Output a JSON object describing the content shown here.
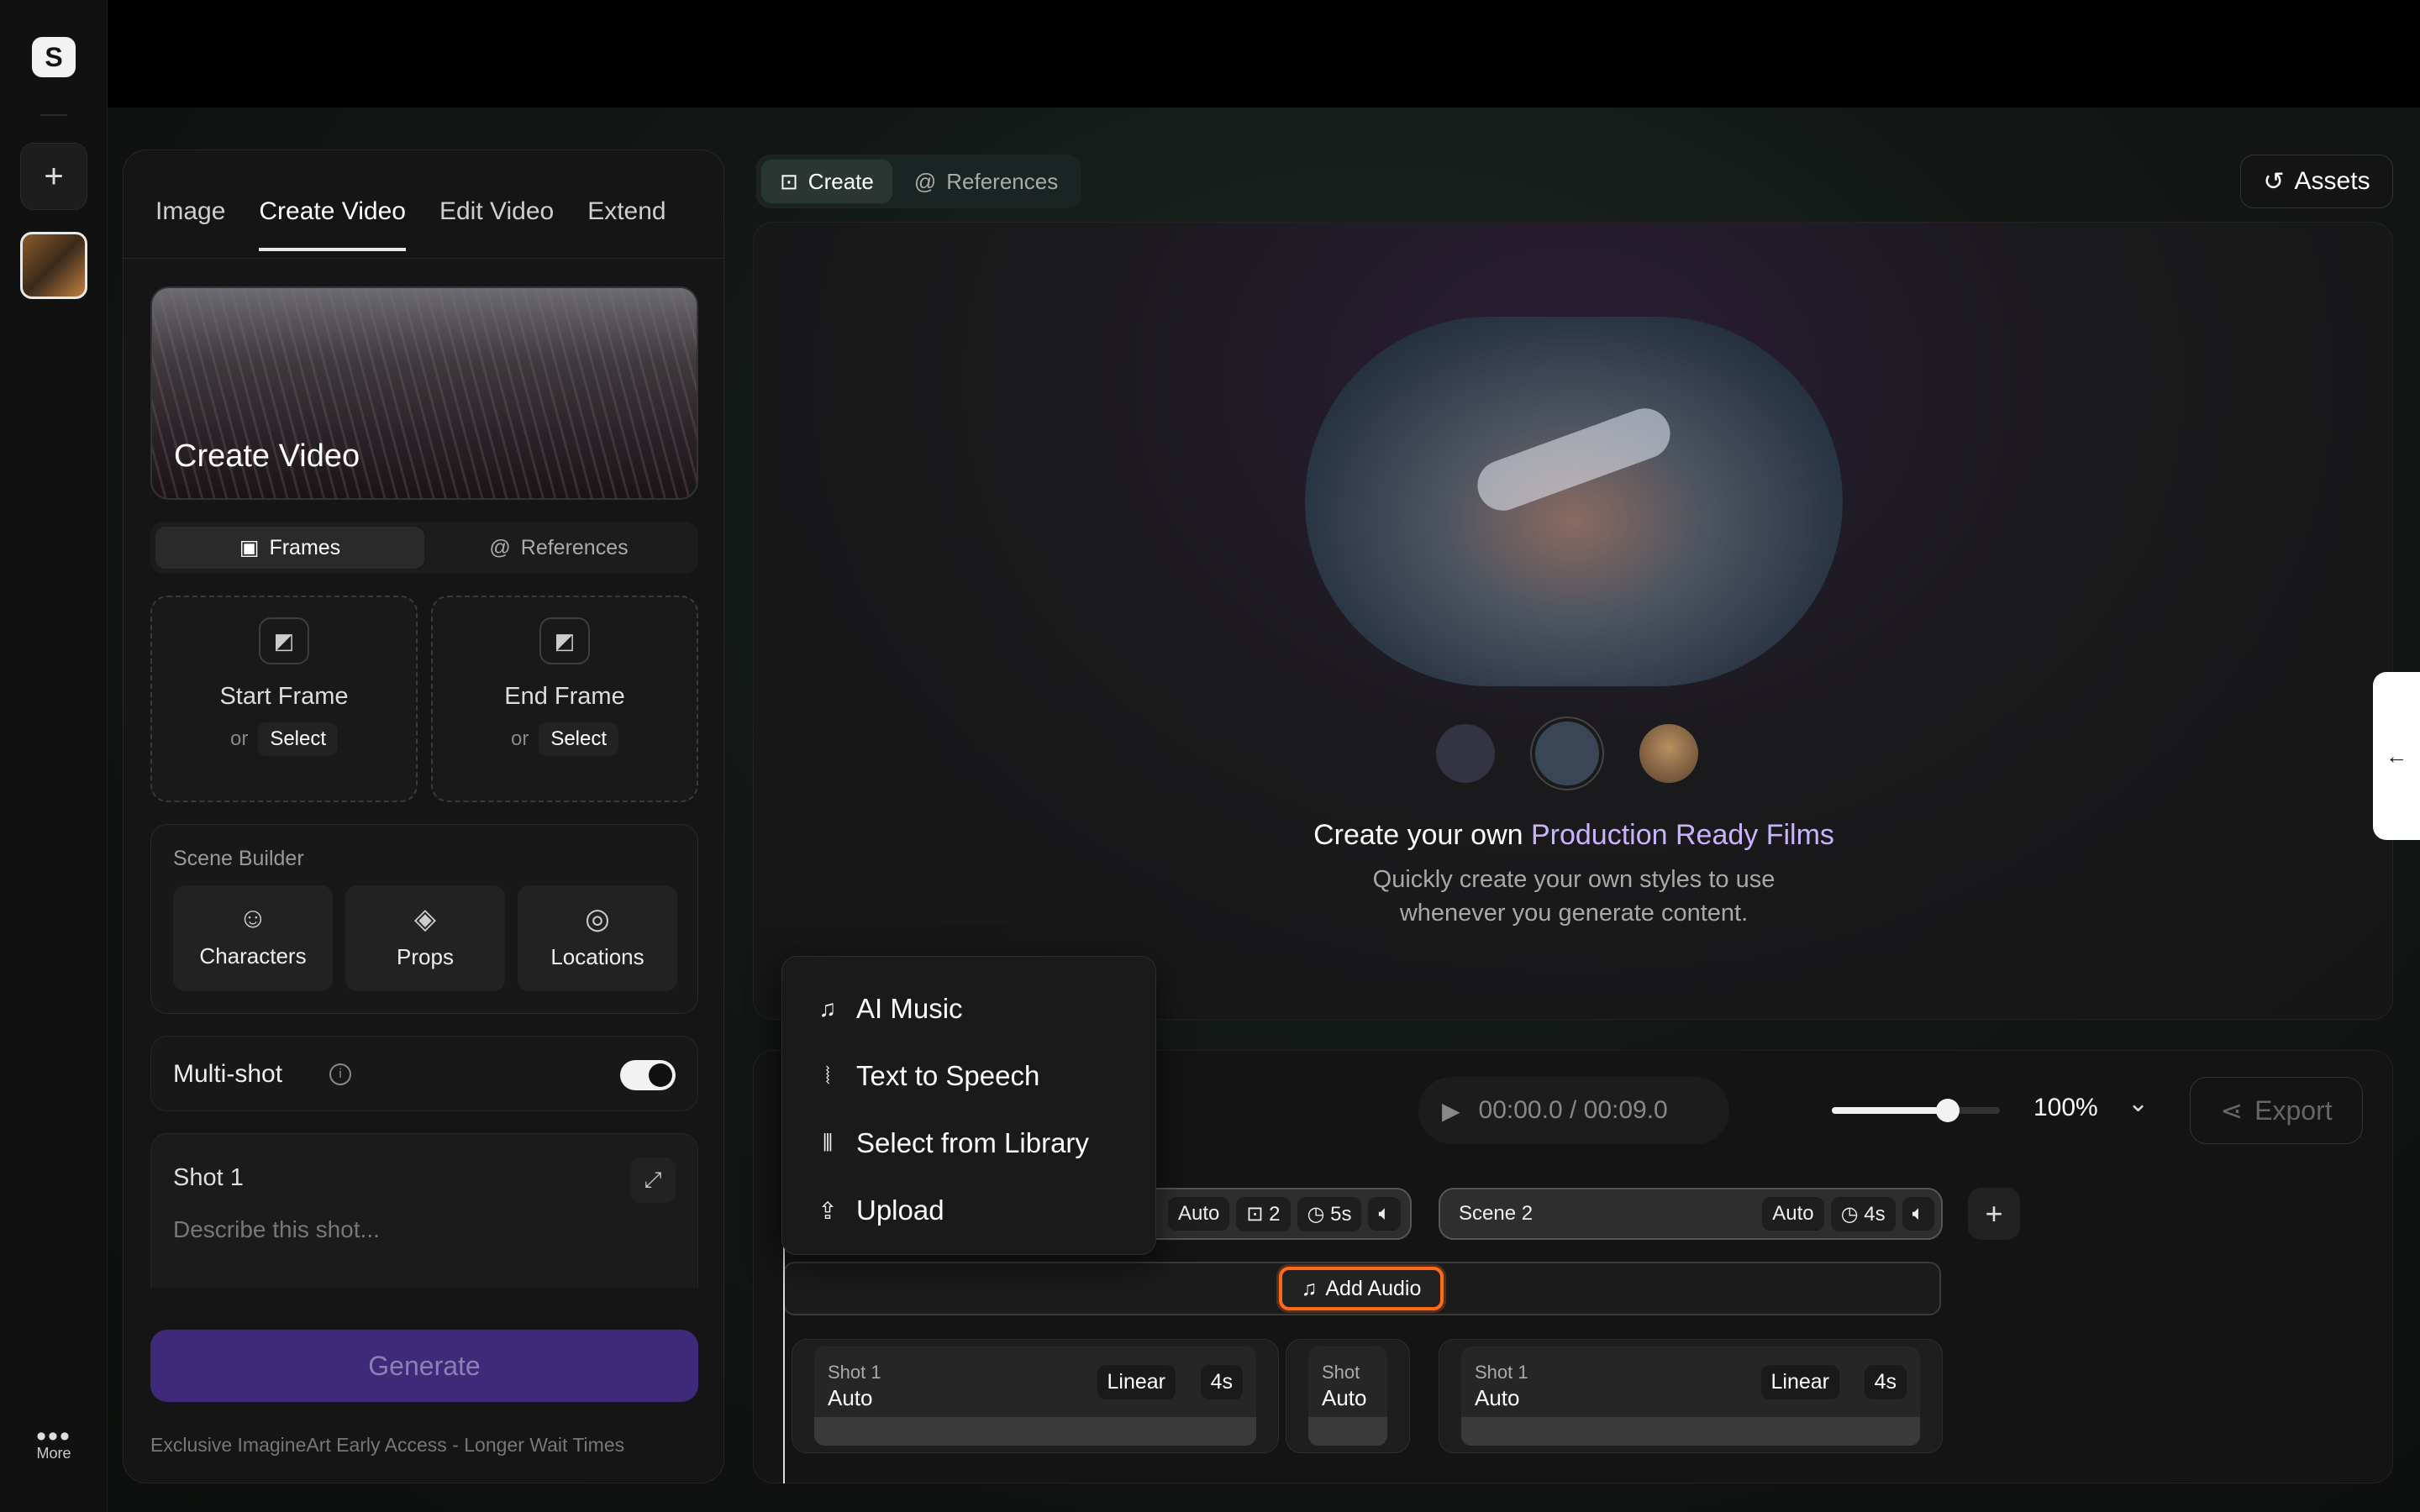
{
  "rail": {
    "more_label": "More"
  },
  "left_panel": {
    "tabs": [
      "Image",
      "Create Video",
      "Edit Video",
      "Extend"
    ],
    "hero_title": "Create Video",
    "segment": [
      "Frames",
      "References"
    ],
    "start_frame": {
      "title": "Start Frame",
      "or": "or",
      "select": "Select"
    },
    "end_frame": {
      "title": "End Frame",
      "or": "or",
      "select": "Select"
    },
    "scene_builder": {
      "label": "Scene Builder",
      "items": [
        "Characters",
        "Props",
        "Locations"
      ]
    },
    "multishot_label": "Multi-shot",
    "shot": {
      "title": "Shot 1",
      "placeholder": "Describe this shot..."
    },
    "generate_label": "Generate",
    "note": "Exclusive ImagineArt Early Access - Longer Wait Times"
  },
  "top": {
    "segment": [
      "Create",
      "References"
    ],
    "assets_label": "Assets"
  },
  "preview": {
    "title_plain": "Create your own ",
    "title_accent": "Production Ready Films",
    "subtitle_line1": "Quickly create your own styles to use",
    "subtitle_line2": "whenever you generate content."
  },
  "timeline": {
    "time": "00:00.0 / 00:09.0",
    "zoom": "100%",
    "zoom_level": 0.69,
    "export_label": "Export",
    "scene1": {
      "mode": "Auto",
      "shots": "2",
      "duration": "5s"
    },
    "scene2": {
      "name": "Scene 2",
      "mode": "Auto",
      "duration": "4s"
    },
    "add_audio_label": "Add Audio",
    "shots": [
      {
        "label": "Shot 1",
        "value": "Auto",
        "curve": "Linear",
        "duration": "4s"
      },
      {
        "label": "Shot",
        "value": "Auto"
      },
      {
        "label": "Shot 1",
        "value": "Auto",
        "curve": "Linear",
        "duration": "4s"
      }
    ]
  },
  "audio_menu": {
    "items": [
      "AI Music",
      "Text to Speech",
      "Select from Library",
      "Upload"
    ]
  },
  "colors": {
    "accent": "#c9b3ff",
    "generate_bg": "#3d2a78",
    "highlight": "#ff6a1a"
  }
}
